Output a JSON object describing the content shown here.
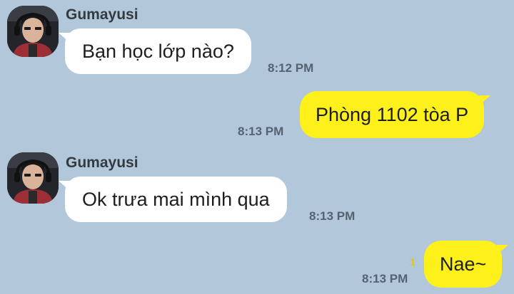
{
  "chat": {
    "background_color": "#b2c7da",
    "incoming_bubble_color": "#ffffff",
    "outgoing_bubble_color": "#fef01b",
    "messages": [
      {
        "sender": "Gumayusi",
        "text": "Bạn học lớp nào?",
        "time": "8:12 PM",
        "direction": "incoming"
      },
      {
        "text": "Phòng 1102 tòa P",
        "time": "8:13 PM",
        "direction": "outgoing"
      },
      {
        "sender": "Gumayusi",
        "text": "Ok trưa mai mình qua",
        "time": "8:13 PM",
        "direction": "incoming"
      },
      {
        "text": "Nae~",
        "time": "8:13 PM",
        "direction": "outgoing",
        "unread_count": "1"
      }
    ]
  }
}
